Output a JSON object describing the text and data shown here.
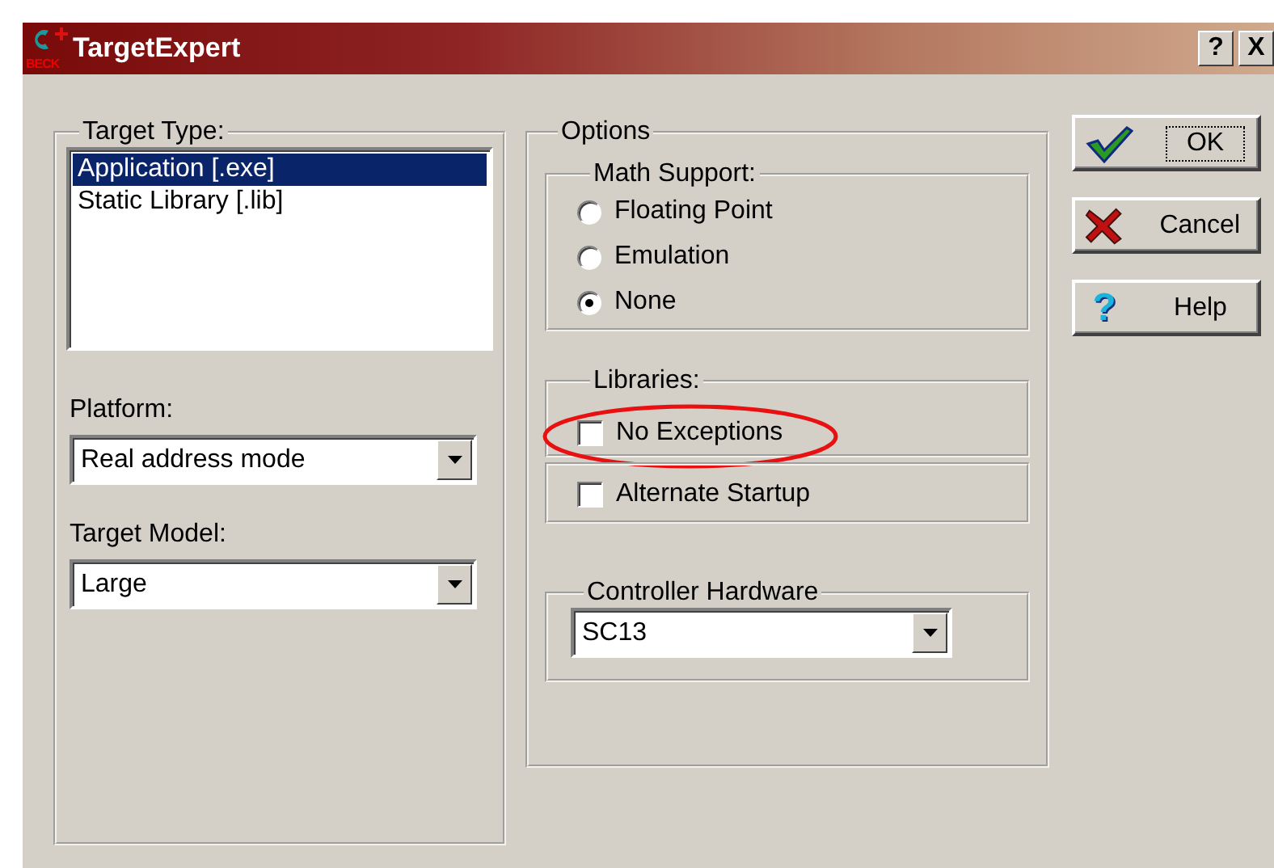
{
  "window": {
    "title": "TargetExpert",
    "icon_text": "BECK",
    "caption_buttons": [
      {
        "kind": "help",
        "label": "?"
      },
      {
        "kind": "close",
        "label": "X"
      }
    ]
  },
  "target_type": {
    "label": "Target Type:",
    "items": [
      {
        "label": "Application [.exe]",
        "selected": true
      },
      {
        "label": "Static Library [.lib]",
        "selected": false
      }
    ]
  },
  "platform": {
    "label": "Platform:",
    "value": "Real address mode"
  },
  "target_model": {
    "label": "Target Model:",
    "value": "Large"
  },
  "options": {
    "label": "Options",
    "math_support": {
      "label": "Math Support:",
      "choices": [
        {
          "label": "Floating Point",
          "selected": false
        },
        {
          "label": "Emulation",
          "selected": false
        },
        {
          "label": "None",
          "selected": true
        }
      ]
    },
    "libraries": {
      "label": "Libraries:",
      "checkboxes": [
        {
          "label": "No Exceptions",
          "checked": false,
          "highlighted": true
        }
      ]
    },
    "startup": {
      "checkboxes": [
        {
          "label": "Alternate Startup",
          "checked": false,
          "highlighted": false
        }
      ]
    },
    "controller_hardware": {
      "label": "Controller Hardware",
      "value": "SC13"
    }
  },
  "buttons": [
    {
      "kind": "ok",
      "label": "OK",
      "focused": true
    },
    {
      "kind": "cancel",
      "label": "Cancel",
      "focused": false
    },
    {
      "kind": "help",
      "label": "Help",
      "icon": "?",
      "focused": false
    }
  ]
}
